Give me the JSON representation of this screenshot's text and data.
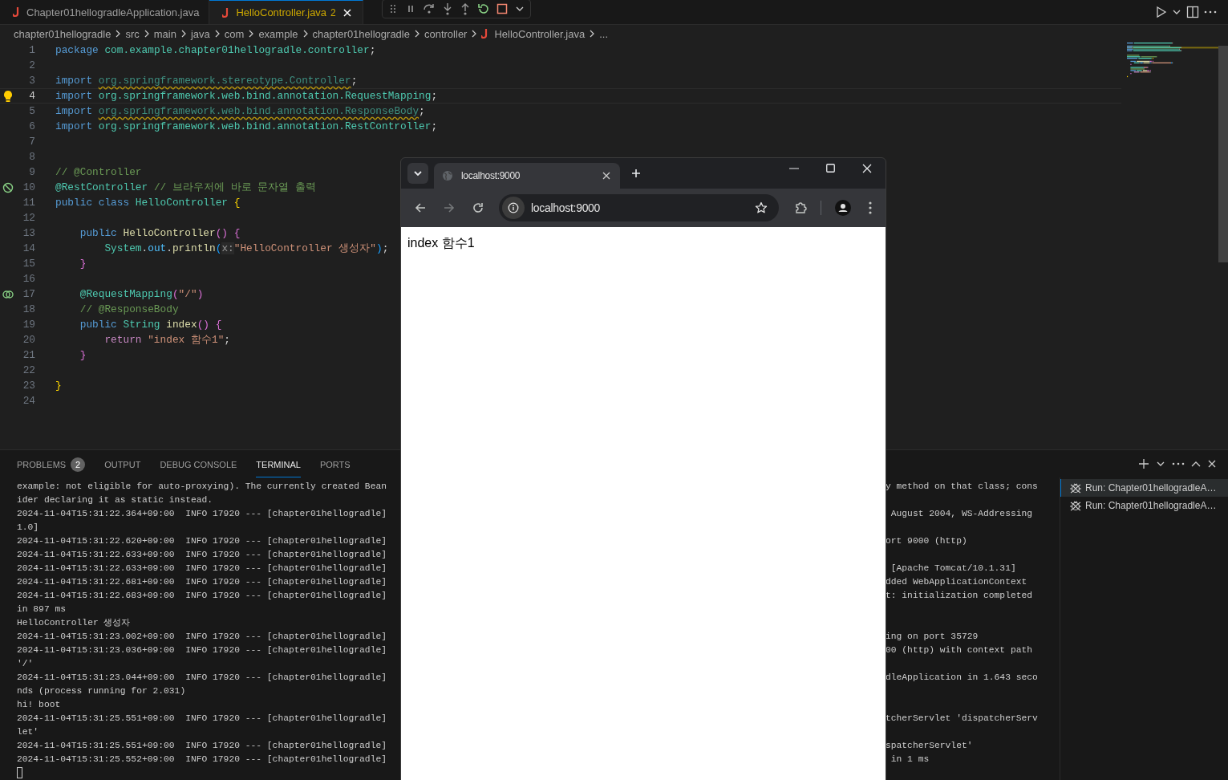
{
  "editor_tabs": [
    {
      "label": "Chapter01hellogradleApplication.java",
      "selected": false
    },
    {
      "label": "HelloController.java",
      "badge": "2",
      "selected": true
    }
  ],
  "breadcrumbs": [
    {
      "label": "chapter01hellogradle",
      "kind": "folder"
    },
    {
      "label": "src",
      "kind": "folder"
    },
    {
      "label": "main",
      "kind": "folder"
    },
    {
      "label": "java",
      "kind": "folder"
    },
    {
      "label": "com",
      "kind": "folder"
    },
    {
      "label": "example",
      "kind": "folder"
    },
    {
      "label": "chapter01hellogradle",
      "kind": "folder"
    },
    {
      "label": "controller",
      "kind": "folder"
    },
    {
      "label": "HelloController.java",
      "kind": "file"
    },
    {
      "label": "...",
      "kind": "more"
    }
  ],
  "code_lines": [
    {
      "number": "1",
      "current": false,
      "kind": "plain",
      "tokens": [
        {
          "kind": "kw",
          "text": "package"
        },
        {
          "kind": "ns",
          "text": " com.example.chapter01hellogradle.controller"
        },
        {
          "kind": "plain",
          "text": ";"
        }
      ]
    },
    {
      "number": "2",
      "current": false,
      "kind": "plain"
    },
    {
      "number": "3",
      "current": false,
      "kind": "plain",
      "tokens": [
        {
          "kind": "kw",
          "text": "import "
        },
        {
          "kind": "unused",
          "text": "org.springframework.stereotype.Controller"
        },
        {
          "kind": "plain",
          "text": ";"
        }
      ]
    },
    {
      "number": "4",
      "current": true,
      "kind": "bulb",
      "tokens": [
        {
          "kind": "kw",
          "text": "import"
        },
        {
          "kind": "ns",
          "text": " org.springframework.web.bind.annotation.RequestMapping"
        },
        {
          "kind": "plain",
          "text": ";"
        }
      ]
    },
    {
      "number": "5",
      "current": false,
      "kind": "plain",
      "tokens": [
        {
          "kind": "kw",
          "text": "import "
        },
        {
          "kind": "unused",
          "text": "org.springframework.web.bind.annotation.ResponseBody"
        },
        {
          "kind": "plain",
          "text": ";"
        }
      ]
    },
    {
      "number": "6",
      "current": false,
      "kind": "plain",
      "tokens": [
        {
          "kind": "kw",
          "text": "import"
        },
        {
          "kind": "ns",
          "text": " org.springframework.web.bind.annotation.RestController"
        },
        {
          "kind": "plain",
          "text": ";"
        }
      ]
    },
    {
      "number": "7",
      "current": false,
      "kind": "plain"
    },
    {
      "number": "8",
      "current": false,
      "kind": "plain"
    },
    {
      "number": "9",
      "current": false,
      "kind": "plain",
      "tokens": [
        {
          "kind": "cmt",
          "text": "// @Controller"
        }
      ]
    },
    {
      "number": "10",
      "current": false,
      "kind": "no-entry",
      "tokens": [
        {
          "kind": "type",
          "text": "@RestController"
        },
        {
          "kind": "cmt",
          "text": " // 브라우저에 바로 문자열 출력"
        }
      ]
    },
    {
      "number": "11",
      "current": false,
      "kind": "plain",
      "tokens": [
        {
          "kind": "kw",
          "text": "public class"
        },
        {
          "kind": "type",
          "text": " HelloController"
        },
        {
          "kind": "brace1",
          "text": " {"
        }
      ]
    },
    {
      "number": "12",
      "current": false,
      "kind": "plain"
    },
    {
      "number": "13",
      "current": false,
      "kind": "plain",
      "tokens": [
        {
          "kind": "kw",
          "text": "    public"
        },
        {
          "kind": "fn",
          "text": " HelloController"
        },
        {
          "kind": "brace2",
          "text": "()"
        },
        {
          "kind": "brace2",
          "text": " {"
        }
      ]
    },
    {
      "number": "14",
      "current": false,
      "kind": "plain",
      "tokens": [
        {
          "kind": "type",
          "text": "        System"
        },
        {
          "kind": "plain",
          "text": "."
        },
        {
          "kind": "var",
          "text": "out"
        },
        {
          "kind": "plain",
          "text": "."
        },
        {
          "kind": "fn",
          "text": "println"
        },
        {
          "kind": "brace3",
          "text": "("
        },
        {
          "kind": "hint",
          "text": "x:"
        },
        {
          "kind": "str",
          "text": "\"HelloController 생성자\""
        },
        {
          "kind": "brace3",
          "text": ")"
        },
        {
          "kind": "plain",
          "text": ";"
        }
      ]
    },
    {
      "number": "15",
      "current": false,
      "kind": "plain",
      "tokens": [
        {
          "kind": "brace2",
          "text": "    }"
        }
      ]
    },
    {
      "number": "16",
      "current": false,
      "kind": "plain"
    },
    {
      "number": "17",
      "current": false,
      "kind": "link",
      "tokens": [
        {
          "kind": "type",
          "text": "    @RequestMapping"
        },
        {
          "kind": "brace2",
          "text": "("
        },
        {
          "kind": "str",
          "text": "\"/\""
        },
        {
          "kind": "brace2",
          "text": ")"
        }
      ]
    },
    {
      "number": "18",
      "current": false,
      "kind": "plain",
      "tokens": [
        {
          "kind": "cmt",
          "text": "    // @ResponseBody"
        }
      ]
    },
    {
      "number": "19",
      "current": false,
      "kind": "plain",
      "tokens": [
        {
          "kind": "kw",
          "text": "    public"
        },
        {
          "kind": "type",
          "text": " String"
        },
        {
          "kind": "fn",
          "text": " index"
        },
        {
          "kind": "brace2",
          "text": "()"
        },
        {
          "kind": "brace2",
          "text": " {"
        }
      ]
    },
    {
      "number": "20",
      "current": false,
      "kind": "plain",
      "tokens": [
        {
          "kind": "ctrl",
          "text": "        return"
        },
        {
          "kind": "str",
          "text": " \"index 함수1\""
        },
        {
          "kind": "plain",
          "text": ";"
        }
      ]
    },
    {
      "number": "21",
      "current": false,
      "kind": "plain",
      "tokens": [
        {
          "kind": "brace2",
          "text": "    }"
        }
      ]
    },
    {
      "number": "22",
      "current": false,
      "kind": "plain"
    },
    {
      "number": "23",
      "current": false,
      "kind": "plain",
      "tokens": [
        {
          "kind": "brace1",
          "text": "}"
        }
      ]
    },
    {
      "number": "24",
      "current": false,
      "kind": "plain"
    }
  ],
  "panel_tabs": [
    {
      "label": "PROBLEMS",
      "badge": "2",
      "selected": false
    },
    {
      "label": "OUTPUT",
      "selected": false
    },
    {
      "label": "DEBUG CONSOLE",
      "selected": false
    },
    {
      "label": "TERMINAL",
      "selected": true
    },
    {
      "label": "PORTS",
      "selected": false
    }
  ],
  "terminal_lines": [
    {
      "left": "example: not eligible for auto-proxying). The currently created Bean",
      "right": "y method on that class; cons"
    },
    {
      "left": "ider declaring it as static instead."
    },
    {
      "left": "2024-11-04T15:31:22.364+09:00  INFO 17920 --- [chapter01hellogradle]",
      "right": " August 2004, WS-Addressing"
    },
    {
      "left": "1.0]"
    },
    {
      "left": "2024-11-04T15:31:22.620+09:00  INFO 17920 --- [chapter01hellogradle]",
      "right": "ort 9000 (http)"
    },
    {
      "left": "2024-11-04T15:31:22.633+09:00  INFO 17920 --- [chapter01hellogradle]"
    },
    {
      "left": "2024-11-04T15:31:22.633+09:00  INFO 17920 --- [chapter01hellogradle]",
      "right": " [Apache Tomcat/10.1.31]"
    },
    {
      "left": "2024-11-04T15:31:22.681+09:00  INFO 17920 --- [chapter01hellogradle]",
      "right": "dded WebApplicationContext"
    },
    {
      "left": "2024-11-04T15:31:22.683+09:00  INFO 17920 --- [chapter01hellogradle]",
      "right": "t: initialization completed"
    },
    {
      "left": "in 897 ms"
    },
    {
      "left": "HelloController 생성자"
    },
    {
      "left": "2024-11-04T15:31:23.002+09:00  INFO 17920 --- [chapter01hellogradle]",
      "right": "ing on port 35729"
    },
    {
      "left": "2024-11-04T15:31:23.036+09:00  INFO 17920 --- [chapter01hellogradle]",
      "right": "00 (http) with context path"
    },
    {
      "left": "'/'"
    },
    {
      "left": "2024-11-04T15:31:23.044+09:00  INFO 17920 --- [chapter01hellogradle]",
      "right": "dleApplication in 1.643 seco"
    },
    {
      "left": "nds (process running for 2.031)"
    },
    {
      "left": "hi! boot"
    },
    {
      "left": "2024-11-04T15:31:25.551+09:00  INFO 17920 --- [chapter01hellogradle]",
      "right": "tcherServlet 'dispatcherServ"
    },
    {
      "left": "let'"
    },
    {
      "left": "2024-11-04T15:31:25.551+09:00  INFO 17920 --- [chapter01hellogradle]",
      "right": "spatcherServlet'"
    },
    {
      "left": "2024-11-04T15:31:25.552+09:00  INFO 17920 --- [chapter01hellogradle]",
      "right": " in 1 ms"
    }
  ],
  "terminal_sessions": [
    {
      "label": "Run: Chapter01hellogradleA…",
      "selected": true
    },
    {
      "label": "Run: Chapter01hellogradleA…",
      "selected": false
    }
  ],
  "browser": {
    "tab_title": "localhost:9000",
    "address": "localhost:9000",
    "page_text": "index 함수1"
  }
}
